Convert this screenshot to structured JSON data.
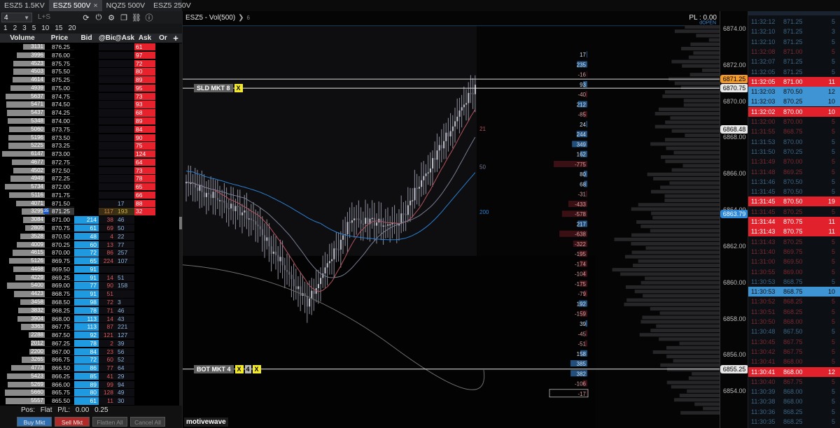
{
  "tabs": [
    {
      "label": "ESZ5 1.5KV",
      "active": false
    },
    {
      "label": "ESZ5 500V",
      "active": true
    },
    {
      "label": "NQZ5 500V",
      "active": false
    },
    {
      "label": "ESZ5 250V",
      "active": false
    }
  ],
  "tab_close": "×",
  "dom_toolbar": {
    "quantity": "4",
    "mode": "L+S",
    "icons": [
      "refresh-icon",
      "power-icon",
      "gear-icon",
      "copy-icon",
      "link-icon",
      "info-icon"
    ]
  },
  "qty_presets": [
    "1",
    "2",
    "3",
    "5",
    "10",
    "15",
    "20"
  ],
  "ladder_headers": {
    "volume": "Volume",
    "price": "Price",
    "bid": "Bid",
    "at_bid": "@Bid",
    "at_ask": "@Ask",
    "ask": "Ask",
    "orders": "Or",
    "add": "+"
  },
  "ladder_rows": [
    {
      "vol": "3131",
      "price": "876.25",
      "bid": "",
      "ab": "",
      "aa": "",
      "ask": "61"
    },
    {
      "vol": "3996",
      "price": "876.00",
      "bid": "",
      "ab": "",
      "aa": "",
      "ask": "97"
    },
    {
      "vol": "4523",
      "price": "875.75",
      "bid": "",
      "ab": "",
      "aa": "",
      "ask": "72"
    },
    {
      "vol": "4503",
      "price": "875.50",
      "bid": "",
      "ab": "",
      "aa": "",
      "ask": "80"
    },
    {
      "vol": "4614",
      "price": "875.25",
      "bid": "",
      "ab": "",
      "aa": "",
      "ask": "89"
    },
    {
      "vol": "4939",
      "price": "875.00",
      "bid": "",
      "ab": "",
      "aa": "",
      "ask": "95"
    },
    {
      "vol": "5637",
      "price": "874.75",
      "bid": "",
      "ab": "",
      "aa": "",
      "ask": "73"
    },
    {
      "vol": "5471",
      "price": "874.50",
      "bid": "",
      "ab": "",
      "aa": "",
      "ask": "93"
    },
    {
      "vol": "5437",
      "price": "874.25",
      "bid": "",
      "ab": "",
      "aa": "",
      "ask": "68"
    },
    {
      "vol": "5348",
      "price": "874.00",
      "bid": "",
      "ab": "",
      "aa": "",
      "ask": "89"
    },
    {
      "vol": "5060",
      "price": "873.75",
      "bid": "",
      "ab": "",
      "aa": "",
      "ask": "84"
    },
    {
      "vol": "5196",
      "price": "873.50",
      "bid": "",
      "ab": "",
      "aa": "",
      "ask": "90"
    },
    {
      "vol": "5225",
      "price": "873.25",
      "bid": "",
      "ab": "",
      "aa": "",
      "ask": "75"
    },
    {
      "vol": "6147",
      "price": "873.00",
      "bid": "",
      "ab": "",
      "aa": "",
      "ask": "124"
    },
    {
      "vol": "4677",
      "price": "872.75",
      "bid": "",
      "ab": "",
      "aa": "",
      "ask": "64"
    },
    {
      "vol": "4502",
      "price": "872.50",
      "bid": "",
      "ab": "",
      "aa": "",
      "ask": "73"
    },
    {
      "vol": "4949",
      "price": "872.25",
      "bid": "",
      "ab": "",
      "aa": "",
      "ask": "78"
    },
    {
      "vol": "5734",
      "price": "872.00",
      "bid": "",
      "ab": "",
      "aa": "",
      "ask": "65"
    },
    {
      "vol": "5116",
      "price": "871.75",
      "bid": "",
      "ab": "",
      "aa": "",
      "ask": "66"
    },
    {
      "vol": "4071",
      "price": "871.50",
      "bid": "",
      "ab": "",
      "aa": "17",
      "ask": "88"
    },
    {
      "vol": "3295",
      "price": "871.25",
      "bid": "",
      "ab": "117",
      "aa": "193",
      "ask": "32",
      "last": true,
      "last_qty": "35"
    },
    {
      "vol": "3084",
      "price": "871.00",
      "bid": "214",
      "ab": "38",
      "aa": "46",
      "ask": ""
    },
    {
      "vol": "2805",
      "price": "870.75",
      "bid": "61",
      "ab": "69",
      "aa": "50",
      "ask": ""
    },
    {
      "vol": "3528",
      "price": "870.50",
      "bid": "48",
      "ab": "4",
      "aa": "22",
      "ask": ""
    },
    {
      "vol": "4009",
      "price": "870.25",
      "bid": "60",
      "ab": "13",
      "aa": "77",
      "ask": ""
    },
    {
      "vol": "4615",
      "price": "870.00",
      "bid": "72",
      "ab": "86",
      "aa": "257",
      "ask": ""
    },
    {
      "vol": "5126",
      "price": "869.75",
      "bid": "65",
      "ab": "224",
      "aa": "107",
      "ask": ""
    },
    {
      "vol": "4468",
      "price": "869.50",
      "bid": "91",
      "ab": "",
      "aa": "",
      "ask": ""
    },
    {
      "vol": "4229",
      "price": "869.25",
      "bid": "91",
      "ab": "14",
      "aa": "51",
      "ask": ""
    },
    {
      "vol": "5400",
      "price": "869.00",
      "bid": "77",
      "ab": "90",
      "aa": "158",
      "ask": ""
    },
    {
      "vol": "4423",
      "price": "868.75",
      "bid": "91",
      "ab": "51",
      "aa": "",
      "ask": ""
    },
    {
      "vol": "3458",
      "price": "868.50",
      "bid": "98",
      "ab": "72",
      "aa": "3",
      "ask": ""
    },
    {
      "vol": "3832",
      "price": "868.25",
      "bid": "78",
      "ab": "71",
      "aa": "46",
      "ask": ""
    },
    {
      "vol": "3904",
      "price": "868.00",
      "bid": "113",
      "ab": "14",
      "aa": "43",
      "ask": ""
    },
    {
      "vol": "3363",
      "price": "867.75",
      "bid": "113",
      "ab": "87",
      "aa": "221",
      "ask": ""
    },
    {
      "vol": "2288",
      "price": "867.50",
      "bid": "92",
      "ab": "121",
      "aa": "127",
      "ask": ""
    },
    {
      "vol": "2012",
      "price": "867.25",
      "bid": "78",
      "ab": "2",
      "aa": "39",
      "ask": ""
    },
    {
      "vol": "2200",
      "price": "867.00",
      "bid": "84",
      "ab": "23",
      "aa": "56",
      "ask": ""
    },
    {
      "vol": "3265",
      "price": "866.75",
      "bid": "72",
      "ab": "60",
      "aa": "52",
      "ask": ""
    },
    {
      "vol": "4773",
      "price": "866.50",
      "bid": "86",
      "ab": "77",
      "aa": "64",
      "ask": ""
    },
    {
      "vol": "5423",
      "price": "866.25",
      "bid": "85",
      "ab": "41",
      "aa": "29",
      "ask": ""
    },
    {
      "vol": "5269",
      "price": "866.00",
      "bid": "89",
      "ab": "99",
      "aa": "94",
      "ask": ""
    },
    {
      "vol": "5660",
      "price": "865.75",
      "bid": "80",
      "ab": "128",
      "aa": "49",
      "ask": ""
    },
    {
      "vol": "5557",
      "price": "865.50",
      "bid": "61",
      "ab": "11",
      "aa": "30",
      "ask": ""
    }
  ],
  "position": {
    "pos_label": "Pos:",
    "pos_value": "Flat",
    "pl_label": "P/L:",
    "pl_value": "0.00",
    "tick": "0.25"
  },
  "order_buttons": {
    "buy": "Buy Mkt",
    "sell": "Sell Mkt",
    "flatten": "Flatten All",
    "cancel": "Cancel All"
  },
  "chart": {
    "title": "ESZ5 - Vol(500)",
    "title_small": "6",
    "pl": "PL : 0.00",
    "dopen": "dOPEN",
    "watermark": "motivewave",
    "ma_labels": [
      "21",
      "50",
      "200"
    ],
    "sold_tag": "SLD MKT 8",
    "bot_tag": "BOT MKT 4",
    "bot_qty": "4",
    "x_label": "X",
    "delta_values": [
      "17",
      "235",
      "-16",
      "93",
      "-40",
      "212",
      "-85",
      "24",
      "244",
      "349",
      "162",
      "-775",
      "80",
      "68",
      "-31",
      "-433",
      "-578",
      "217",
      "-638",
      "-322",
      "-195",
      "-174",
      "-104",
      "-175",
      "-79",
      "192",
      "-159",
      "39",
      "-45",
      "-51",
      "158",
      "385",
      "382",
      "-106",
      "-17"
    ]
  },
  "chart_data": {
    "type": "candlestick",
    "series": [
      {
        "name": "21",
        "color": "#b5545e"
      },
      {
        "name": "50",
        "color": "#7a7f96"
      },
      {
        "name": "200",
        "color": "#2c7fd0"
      }
    ],
    "ylim": [
      6852,
      6875
    ],
    "y_ticks": [
      "6874.00",
      "6872.00",
      "6870.00",
      "6868.00",
      "6866.00",
      "6864.00",
      "6862.00",
      "6860.00",
      "6858.00",
      "6856.00",
      "6854.00"
    ],
    "highlighted": [
      {
        "value": "6871.25",
        "style": "orange"
      },
      {
        "value": "6870.75",
        "style": "white"
      },
      {
        "value": "6868.48",
        "style": "white"
      },
      {
        "value": "6863.79",
        "style": "blue"
      },
      {
        "value": "6855.25",
        "style": "white"
      }
    ]
  },
  "time_sales": [
    {
      "t": "11:32:12",
      "p": "871.25",
      "s": "5",
      "st": "db"
    },
    {
      "t": "11:32:10",
      "p": "871.25",
      "s": "3",
      "st": "db"
    },
    {
      "t": "11:32:10",
      "p": "871.25",
      "s": "5",
      "st": "db"
    },
    {
      "t": "11:32:08",
      "p": "871.00",
      "s": "5",
      "st": "dr"
    },
    {
      "t": "11:32:07",
      "p": "871.25",
      "s": "5",
      "st": "db"
    },
    {
      "t": "11:32:05",
      "p": "871.25",
      "s": "5",
      "st": "db"
    },
    {
      "t": "11:32:05",
      "p": "871.00",
      "s": "11",
      "st": "br"
    },
    {
      "t": "11:32:03",
      "p": "870.50",
      "s": "12",
      "st": "bb"
    },
    {
      "t": "11:32:03",
      "p": "870.25",
      "s": "10",
      "st": "bb"
    },
    {
      "t": "11:32:02",
      "p": "870.00",
      "s": "10",
      "st": "br"
    },
    {
      "t": "11:32:00",
      "p": "870.00",
      "s": "5",
      "st": "dr"
    },
    {
      "t": "11:31:55",
      "p": "868.75",
      "s": "5",
      "st": "dr"
    },
    {
      "t": "11:31:53",
      "p": "870.00",
      "s": "5",
      "st": "db"
    },
    {
      "t": "11:31:50",
      "p": "870.25",
      "s": "5",
      "st": "db"
    },
    {
      "t": "11:31:49",
      "p": "870.00",
      "s": "5",
      "st": "dr"
    },
    {
      "t": "11:31:48",
      "p": "869.25",
      "s": "5",
      "st": "dr"
    },
    {
      "t": "11:31:46",
      "p": "870.50",
      "s": "5",
      "st": "db"
    },
    {
      "t": "11:31:45",
      "p": "870.50",
      "s": "5",
      "st": "db"
    },
    {
      "t": "11:31:45",
      "p": "870.50",
      "s": "19",
      "st": "br"
    },
    {
      "t": "11:31:45",
      "p": "870.25",
      "s": "5",
      "st": "dr"
    },
    {
      "t": "11:31:44",
      "p": "870.75",
      "s": "11",
      "st": "br"
    },
    {
      "t": "11:31:43",
      "p": "870.75",
      "s": "11",
      "st": "br"
    },
    {
      "t": "11:31:43",
      "p": "870.25",
      "s": "5",
      "st": "dr"
    },
    {
      "t": "11:31:40",
      "p": "869.75",
      "s": "5",
      "st": "dr"
    },
    {
      "t": "11:31:00",
      "p": "869.50",
      "s": "5",
      "st": "dr"
    },
    {
      "t": "11:30:55",
      "p": "869.00",
      "s": "5",
      "st": "dr"
    },
    {
      "t": "11:30:53",
      "p": "868.75",
      "s": "5",
      "st": "db"
    },
    {
      "t": "11:30:53",
      "p": "868.75",
      "s": "10",
      "st": "bb"
    },
    {
      "t": "11:30:52",
      "p": "868.25",
      "s": "5",
      "st": "dr"
    },
    {
      "t": "11:30:51",
      "p": "868.25",
      "s": "5",
      "st": "dr"
    },
    {
      "t": "11:30:50",
      "p": "868.00",
      "s": "5",
      "st": "dr"
    },
    {
      "t": "11:30:48",
      "p": "867.50",
      "s": "5",
      "st": "db"
    },
    {
      "t": "11:30:45",
      "p": "867.75",
      "s": "5",
      "st": "dr"
    },
    {
      "t": "11:30:42",
      "p": "867.75",
      "s": "5",
      "st": "dr"
    },
    {
      "t": "11:30:41",
      "p": "868.00",
      "s": "5",
      "st": "dr"
    },
    {
      "t": "11:30:41",
      "p": "868.00",
      "s": "12",
      "st": "br"
    },
    {
      "t": "11:30:40",
      "p": "867.75",
      "s": "5",
      "st": "dr"
    },
    {
      "t": "11:30:39",
      "p": "868.00",
      "s": "5",
      "st": "db"
    },
    {
      "t": "11:30:38",
      "p": "868.00",
      "s": "5",
      "st": "db"
    },
    {
      "t": "11:30:36",
      "p": "868.25",
      "s": "5",
      "st": "db"
    },
    {
      "t": "11:30:35",
      "p": "868.25",
      "s": "5",
      "st": "db"
    }
  ]
}
